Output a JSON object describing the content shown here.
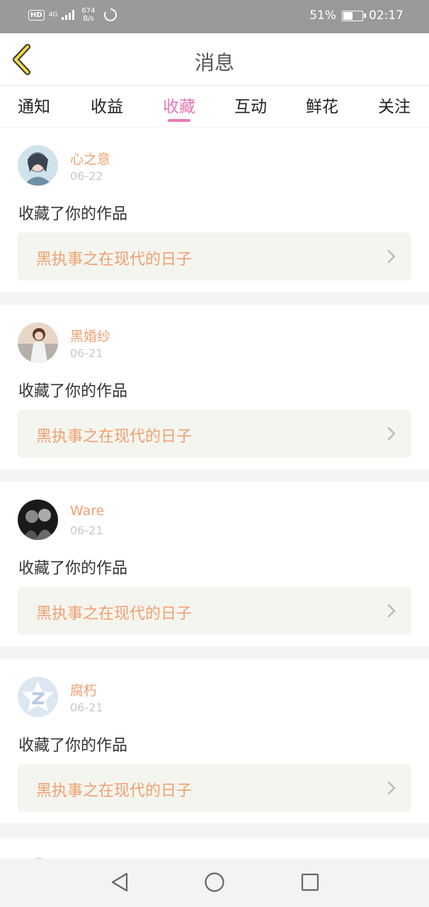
{
  "status_bar": {
    "hd": "HD",
    "network": "4G",
    "speed_value": "674",
    "speed_unit": "B/s",
    "battery_text": "51%",
    "battery_level": 0.51,
    "time": "02:17"
  },
  "header": {
    "title": "消息"
  },
  "tabs": [
    {
      "label": "通知"
    },
    {
      "label": "收益"
    },
    {
      "label": "收藏",
      "active": true
    },
    {
      "label": "互动"
    },
    {
      "label": "鲜花"
    },
    {
      "label": "关注"
    }
  ],
  "items": [
    {
      "user": "心之意",
      "date": "06-22",
      "action": "收藏了你的作品",
      "work": "黑执事之在现代的日子"
    },
    {
      "user": "黑婚纱",
      "date": "06-21",
      "action": "收藏了你的作品",
      "work": "黑执事之在现代的日子"
    },
    {
      "user": "Ware",
      "date": "06-21",
      "action": "收藏了你的作品",
      "work": "黑执事之在现代的日子"
    },
    {
      "user": "腐朽",
      "date": "06-21",
      "action": "收藏了你的作品",
      "work": "黑执事之在现代的日子"
    }
  ],
  "colors": {
    "accent": "#e879b4",
    "username": "#f0a070",
    "status_bar": "#9a9a9a"
  }
}
